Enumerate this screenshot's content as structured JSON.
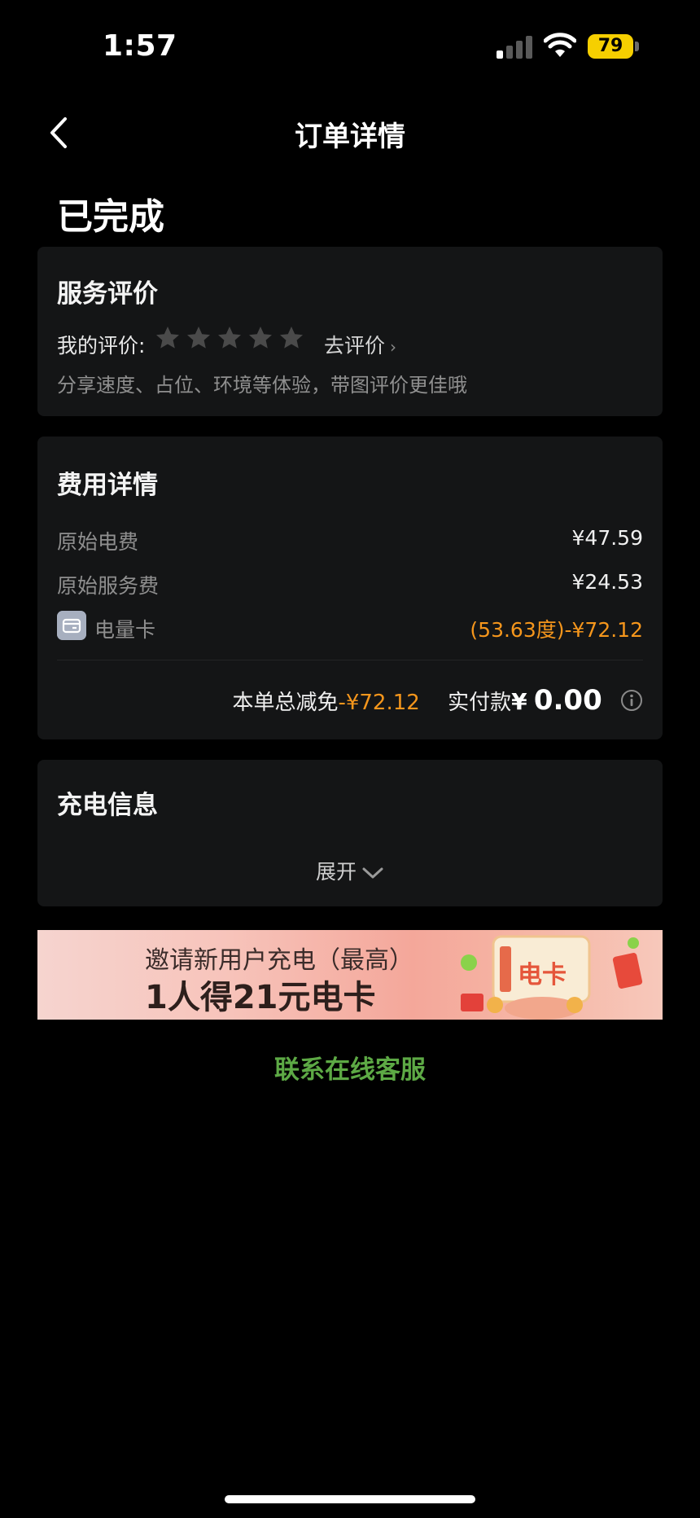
{
  "status_bar": {
    "time": "1:57",
    "battery": "79"
  },
  "nav": {
    "title": "订单详情"
  },
  "order": {
    "status": "已完成"
  },
  "review": {
    "title": "服务评价",
    "my_review_label": "我的评价:",
    "stars_total": 5,
    "stars_filled": 0,
    "go_review_label": "去评价",
    "hint": "分享速度、占位、环境等体验，带图评价更佳哦"
  },
  "fees": {
    "title": "费用详情",
    "rows": [
      {
        "label": "原始电费",
        "value": "¥47.59"
      },
      {
        "label": "原始服务费",
        "value": "¥24.53"
      }
    ],
    "power_card": {
      "label": "电量卡",
      "value": "(53.63度)-¥72.12"
    },
    "discount_label": "本单总减免",
    "discount_value": "-¥72.12",
    "paid_label": "实付款",
    "paid_currency": "¥",
    "paid_amount": "0.00"
  },
  "charging": {
    "title": "充电信息",
    "expand_label": "展开"
  },
  "banner": {
    "line1": "邀请新用户充电（最高）",
    "line2": "1人得21元电卡",
    "card_label": "电卡"
  },
  "contact": {
    "label": "联系在线客服"
  },
  "colors": {
    "background": "#000000",
    "card": "#141516",
    "accent_orange": "#f5961c",
    "accent_green": "#5da945",
    "battery_yellow": "#f6cf00"
  }
}
